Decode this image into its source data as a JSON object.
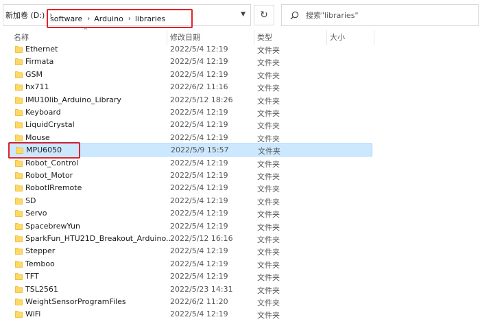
{
  "address": {
    "root": "新加卷 (D:)",
    "path": [
      "software",
      "Arduino",
      "libraries"
    ]
  },
  "search": {
    "placeholder": "搜索\"libraries\""
  },
  "icons": {
    "refresh": "refresh-icon",
    "search": "search-icon",
    "folder": "folder-icon",
    "dropdown": "chevron-down-icon",
    "sort": "sort-ascending-icon"
  },
  "colors": {
    "highlight": "#e0232a",
    "selection": "#cce8ff",
    "folder": "#ffd966"
  },
  "columns": {
    "name": "名称",
    "date": "修改日期",
    "type": "类型",
    "size": "大小"
  },
  "files": [
    {
      "name": "Ethernet",
      "date": "2022/5/4 12:19",
      "type": "文件夹"
    },
    {
      "name": "Firmata",
      "date": "2022/5/4 12:19",
      "type": "文件夹"
    },
    {
      "name": "GSM",
      "date": "2022/5/4 12:19",
      "type": "文件夹"
    },
    {
      "name": "hx711",
      "date": "2022/6/2 11:16",
      "type": "文件夹"
    },
    {
      "name": "IMU10lib_Arduino_Library",
      "date": "2022/5/12 18:26",
      "type": "文件夹"
    },
    {
      "name": "Keyboard",
      "date": "2022/5/4 12:19",
      "type": "文件夹"
    },
    {
      "name": "LiquidCrystal",
      "date": "2022/5/4 12:19",
      "type": "文件夹"
    },
    {
      "name": "Mouse",
      "date": "2022/5/4 12:19",
      "type": "文件夹"
    },
    {
      "name": "MPU6050",
      "date": "2022/5/9 15:57",
      "type": "文件夹",
      "selected": true
    },
    {
      "name": "Robot_Control",
      "date": "2022/5/4 12:19",
      "type": "文件夹"
    },
    {
      "name": "Robot_Motor",
      "date": "2022/5/4 12:19",
      "type": "文件夹"
    },
    {
      "name": "RobotIRremote",
      "date": "2022/5/4 12:19",
      "type": "文件夹"
    },
    {
      "name": "SD",
      "date": "2022/5/4 12:19",
      "type": "文件夹"
    },
    {
      "name": "Servo",
      "date": "2022/5/4 12:19",
      "type": "文件夹"
    },
    {
      "name": "SpacebrewYun",
      "date": "2022/5/4 12:19",
      "type": "文件夹"
    },
    {
      "name": "SparkFun_HTU21D_Breakout_Arduino...",
      "date": "2022/5/12 16:16",
      "type": "文件夹"
    },
    {
      "name": "Stepper",
      "date": "2022/5/4 12:19",
      "type": "文件夹"
    },
    {
      "name": "Temboo",
      "date": "2022/5/4 12:19",
      "type": "文件夹"
    },
    {
      "name": "TFT",
      "date": "2022/5/4 12:19",
      "type": "文件夹"
    },
    {
      "name": "TSL2561",
      "date": "2022/5/23 14:31",
      "type": "文件夹"
    },
    {
      "name": "WeightSensorProgramFiles",
      "date": "2022/6/2 11:20",
      "type": "文件夹"
    },
    {
      "name": "WiFi",
      "date": "2022/5/4 12:19",
      "type": "文件夹"
    }
  ]
}
